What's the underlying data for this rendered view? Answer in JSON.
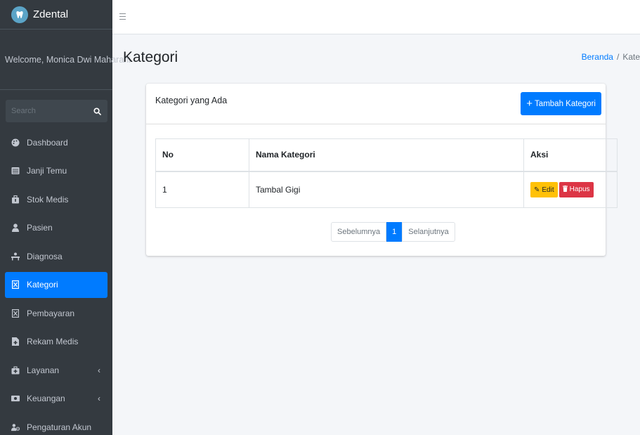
{
  "brand": {
    "name": "Zdental",
    "logo_icon": "tooth-logo"
  },
  "user": {
    "welcome": "Welcome, Monica Dwi Maharani"
  },
  "search": {
    "placeholder": "Search"
  },
  "sidebar": {
    "items": [
      {
        "label": "Dashboard",
        "icon": "palette-icon",
        "active": false
      },
      {
        "label": "Janji Temu",
        "icon": "list-icon",
        "active": false
      },
      {
        "label": "Stok Medis",
        "icon": "toolbox-icon",
        "active": false
      },
      {
        "label": "Pasien",
        "icon": "user-icon",
        "active": false
      },
      {
        "label": "Diagnosa",
        "icon": "procedures-icon",
        "active": false
      },
      {
        "label": "Kategori",
        "icon": "missing-glyph-icon",
        "active": true
      },
      {
        "label": "Pembayaran",
        "icon": "missing-glyph-icon",
        "active": false
      },
      {
        "label": "Rekam Medis",
        "icon": "file-medical-icon",
        "active": false
      },
      {
        "label": "Layanan",
        "icon": "medkit-icon",
        "active": false,
        "has_submenu": true
      },
      {
        "label": "Keuangan",
        "icon": "money-icon",
        "active": false,
        "has_submenu": true
      },
      {
        "label": "Pengaturan Akun",
        "icon": "users-cog-icon",
        "active": false
      }
    ]
  },
  "header": {
    "title": "Kategori"
  },
  "breadcrumb": {
    "home": "Beranda",
    "separator": "/",
    "current": "Kate"
  },
  "card": {
    "title": "Kategori yang Ada",
    "add_button": "Tambah Kategori"
  },
  "table": {
    "columns": [
      "No",
      "Nama Kategori",
      "Aksi"
    ],
    "rows": [
      {
        "no": "1",
        "name": "Tambal Gigi",
        "edit_label": "Edit",
        "delete_label": "Hapus"
      }
    ]
  },
  "pagination": {
    "prev": "Sebelumnya",
    "current": "1",
    "next": "Selanjutnya"
  },
  "colors": {
    "primary": "#007bff",
    "sidebar_bg": "#343a40",
    "warning": "#ffc107",
    "danger": "#dc3545"
  }
}
